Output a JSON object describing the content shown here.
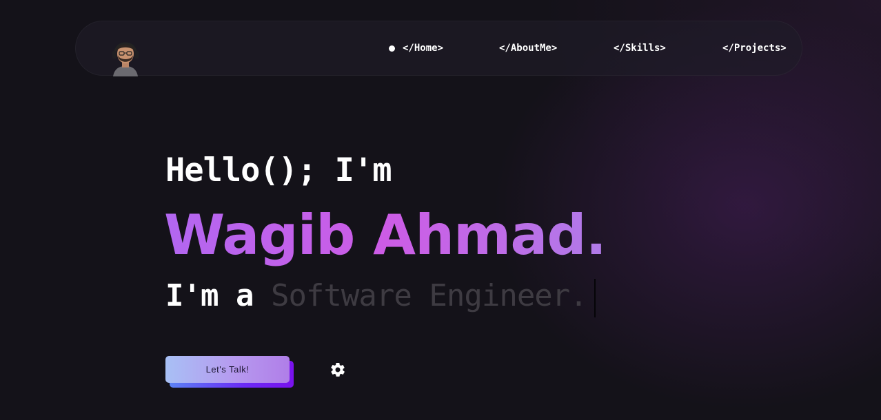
{
  "nav": {
    "avatar_icon": "avatar-icon",
    "items": [
      {
        "label": "</Home>"
      },
      {
        "label": "</AboutMe>"
      },
      {
        "label": "</Skills>"
      },
      {
        "label": "</Projects>"
      }
    ]
  },
  "hero": {
    "greeting": "Hello(); I'm",
    "name": "Wagib Ahmad.",
    "role_prefix": "I'm a ",
    "role_text": "Software Engineer."
  },
  "cta": {
    "label": "Let's Talk!",
    "settings_icon": "gear-icon"
  },
  "colors": {
    "accent": "#c55ae6",
    "background": "#141219"
  }
}
